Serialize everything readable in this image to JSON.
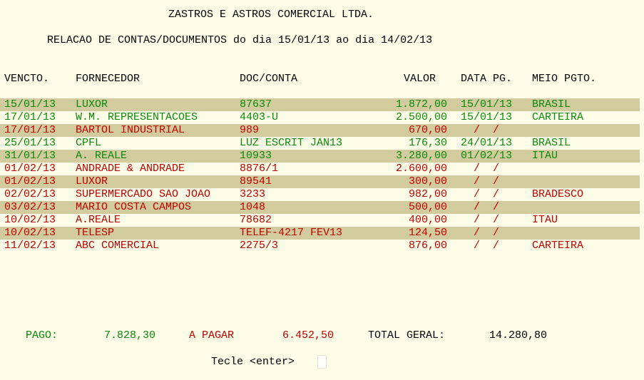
{
  "title": "ZASTROS E ASTROS COMERCIAL LTDA.",
  "subtitle": "RELACAO DE CONTAS/DOCUMENTOS do dia 15/01/13 ao dia 14/02/13",
  "columns": {
    "vencto": "VENCTO.",
    "fornecedor": "FORNECEDOR",
    "doc": "DOC/CONTA",
    "valor": "VALOR",
    "data_pg": "DATA PG.",
    "meio": "MEIO PGTO."
  },
  "rows": [
    {
      "vencto": "15/01/13",
      "fornecedor": "LUXOR",
      "doc": "87637",
      "valor": "1.872,00",
      "data_pg": "15/01/13",
      "meio": "BRASIL",
      "status": "pago"
    },
    {
      "vencto": "17/01/13",
      "fornecedor": "W.M. REPRESENTACOES",
      "doc": "4403-U",
      "valor": "2.500,00",
      "data_pg": "15/01/13",
      "meio": "CARTEIRA",
      "status": "pago"
    },
    {
      "vencto": "17/01/13",
      "fornecedor": "BARTOL INDUSTRIAL",
      "doc": "989",
      "valor": "670,00",
      "data_pg": "  /  /",
      "meio": "",
      "status": "a_pagar"
    },
    {
      "vencto": "25/01/13",
      "fornecedor": "CPFL",
      "doc": "LUZ ESCRIT JAN13",
      "valor": "176,30",
      "data_pg": "24/01/13",
      "meio": "BRASIL",
      "status": "pago"
    },
    {
      "vencto": "31/01/13",
      "fornecedor": "A. REALE",
      "doc": "10933",
      "valor": "3.280,00",
      "data_pg": "01/02/13",
      "meio": "ITAU",
      "status": "pago"
    },
    {
      "vencto": "01/02/13",
      "fornecedor": "ANDRADE & ANDRADE",
      "doc": "8876/1",
      "valor": "2.600,00",
      "data_pg": "  /  /",
      "meio": "",
      "status": "a_pagar"
    },
    {
      "vencto": "01/02/13",
      "fornecedor": "LUXOR",
      "doc": "89541",
      "valor": "300,00",
      "data_pg": "  /  /",
      "meio": "",
      "status": "a_pagar"
    },
    {
      "vencto": "02/02/13",
      "fornecedor": "SUPERMERCADO SAO JOAO",
      "doc": "3233",
      "valor": "982,00",
      "data_pg": "  /  /",
      "meio": "BRADESCO",
      "status": "a_pagar"
    },
    {
      "vencto": "03/02/13",
      "fornecedor": "MARIO COSTA CAMPOS",
      "doc": "1048",
      "valor": "500,00",
      "data_pg": "  /  /",
      "meio": "",
      "status": "a_pagar"
    },
    {
      "vencto": "10/02/13",
      "fornecedor": "A.REALE",
      "doc": "78682",
      "valor": "400,00",
      "data_pg": "  /  /",
      "meio": "ITAU",
      "status": "a_pagar"
    },
    {
      "vencto": "10/02/13",
      "fornecedor": "TELESP",
      "doc": "TELEF-4217 FEV13",
      "valor": "124,50",
      "data_pg": "  /  /",
      "meio": "",
      "status": "a_pagar"
    },
    {
      "vencto": "11/02/13",
      "fornecedor": "ABC COMERCIAL",
      "doc": "2275/3",
      "valor": "876,00",
      "data_pg": "  /  /",
      "meio": "CARTEIRA",
      "status": "a_pagar"
    }
  ],
  "totals": {
    "pago_label": "PAGO:",
    "pago_value": "7.828,30",
    "a_pagar_label": "A PAGAR",
    "a_pagar_value": "6.452,50",
    "total_label": "TOTAL GERAL:",
    "total_value": "14.280,80"
  },
  "prompt": "Tecle <enter>",
  "colors": {
    "background": "#fdfde7",
    "band": "#d2cb9d",
    "paid": "#0a8a0a",
    "unpaid": "#c00000"
  }
}
